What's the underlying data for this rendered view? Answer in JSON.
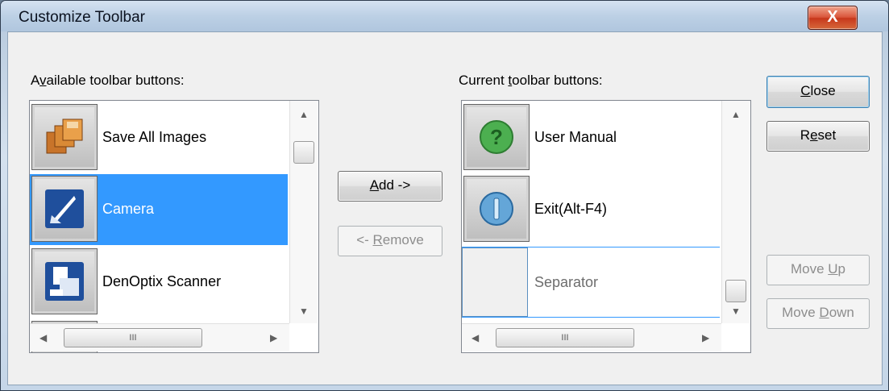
{
  "window": {
    "title": "Customize Toolbar",
    "close_glyph": "X"
  },
  "available": {
    "label_prefix": "A",
    "label_u": "v",
    "label_rest": "ailable toolbar buttons:",
    "items": [
      {
        "label": "Save All Images",
        "icon": "save-all-images-icon"
      },
      {
        "label": "Camera",
        "icon": "camera-icon",
        "selected": true
      },
      {
        "label": "DenOptix Scanner",
        "icon": "scanner-icon"
      }
    ]
  },
  "current": {
    "label_prefix": "Current ",
    "label_u": "t",
    "label_rest": "oolbar buttons:",
    "items": [
      {
        "label": "User Manual",
        "icon": "help-icon"
      },
      {
        "label": "Exit(Alt-F4)",
        "icon": "exit-icon"
      },
      {
        "label": "Separator",
        "icon": "separator"
      }
    ]
  },
  "buttons": {
    "add": {
      "u": "A",
      "rest": "dd ->"
    },
    "remove": {
      "prefix": "<- ",
      "u": "R",
      "rest": "emove"
    },
    "close": {
      "u": "C",
      "rest": "lose"
    },
    "reset": {
      "prefix": "R",
      "u": "e",
      "rest": "set"
    },
    "move_up": {
      "prefix": "Move ",
      "u": "U",
      "rest": "p"
    },
    "move_down": {
      "prefix": "Move ",
      "u": "D",
      "rest": "own"
    }
  },
  "scroll": {
    "up": "▲",
    "down": "▼",
    "left": "◀",
    "right": "▶",
    "grip": "III"
  },
  "colors": {
    "selection": "#3399ff",
    "close_red": "#c7371c"
  }
}
